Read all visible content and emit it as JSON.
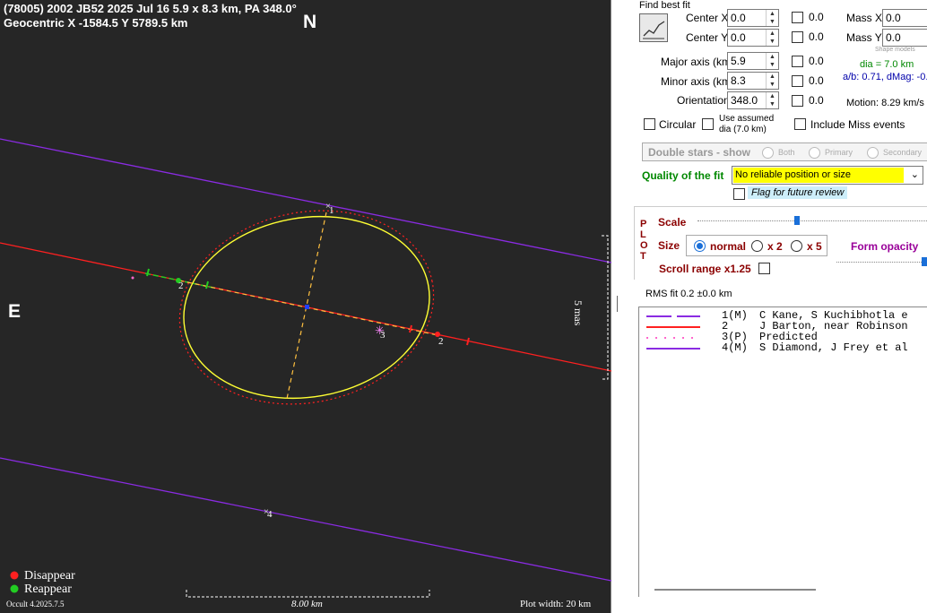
{
  "plot": {
    "title_line1": "(78005) 2002 JB52  2025 Jul 16  5.9 x 8.3 km, PA 348.0°",
    "title_line2": "Geocentric X -1584.5 Y 5789.5 km",
    "north_label": "N",
    "east_label": "E",
    "mas_label": "5 mas",
    "scale_label": "8.00 km",
    "plot_width_label": "Plot width: 20 km",
    "version_label": "Occult 4.2025.7.5",
    "legend_disappear": "Disappear",
    "legend_reappear": "Reappear",
    "chord_labels": [
      "1",
      "2",
      "2",
      "3",
      "4"
    ],
    "colors": {
      "background": "#262626",
      "ellipse": "#ffff33",
      "chord1": "#8a2be2",
      "chord2": "#ff2020",
      "chord4": "#8a2be2",
      "predicted": "#ff2020",
      "reappear": "#22cc22"
    }
  },
  "panel": {
    "find_best_fit": "Find best fit",
    "fit_icon": "fit-graph-icon",
    "center_x_label": "Center X",
    "center_x_value": "0.0",
    "center_y_label": "Center Y",
    "center_y_value": "0.0",
    "major_label": "Major axis (km)",
    "major_value": "5.9",
    "minor_label": "Minor axis (km)",
    "minor_value": "8.3",
    "orient_label": "Orientation",
    "orient_value": "348.0",
    "check_values": [
      "0.0",
      "0.0",
      "0.0",
      "0.0",
      "0.0"
    ],
    "mass_x_label": "Mass X",
    "mass_x_value": "0.0",
    "mass_y_label": "Mass Y",
    "mass_y_value": "0.0",
    "shape_models": "Shape models",
    "dia_text": "dia = 7.0 km",
    "ab_text": "a/b: 0.71, dMag: -0.",
    "motion_text": "Motion: 8.29 km/s",
    "circular_label": "Circular",
    "assumed_label": "Use assumed dia (7.0 km)",
    "include_miss_label": "Include Miss events",
    "double_stars_label": "Double stars - show",
    "both_label": "Both",
    "primary_label": "Primary",
    "secondary_label": "Secondary",
    "quality_label": "Quality of the fit",
    "quality_value": "No reliable position or size",
    "flag_label": "Flag for future review",
    "plot_vertical": [
      "P",
      "L",
      "O",
      "T"
    ],
    "scale_label": "Scale",
    "size_label": "Size",
    "normal_label": "normal",
    "x2_label": "x 2",
    "x5_label": "x 5",
    "form_opacity_label": "Form opacity",
    "scroll_range_label": "Scroll range x1.25",
    "rms_text": "RMS fit 0.2 ±0.0 km",
    "observers": [
      {
        "num": "1(M)",
        "name": "C Kane, S Kuchibhotla e"
      },
      {
        "num": "2",
        "name": "J Barton, near Robinson"
      },
      {
        "num": "3(P)",
        "name": "Predicted"
      },
      {
        "num": "4(M)",
        "name": "S Diamond, J Frey et al"
      }
    ],
    "colors": {
      "dia": "#008800",
      "ab": "#0000aa",
      "quality_bg": "#ffff00",
      "maroon": "#8b0000",
      "flag_bg": "#cdeefa",
      "opacity_label": "#990099"
    }
  }
}
